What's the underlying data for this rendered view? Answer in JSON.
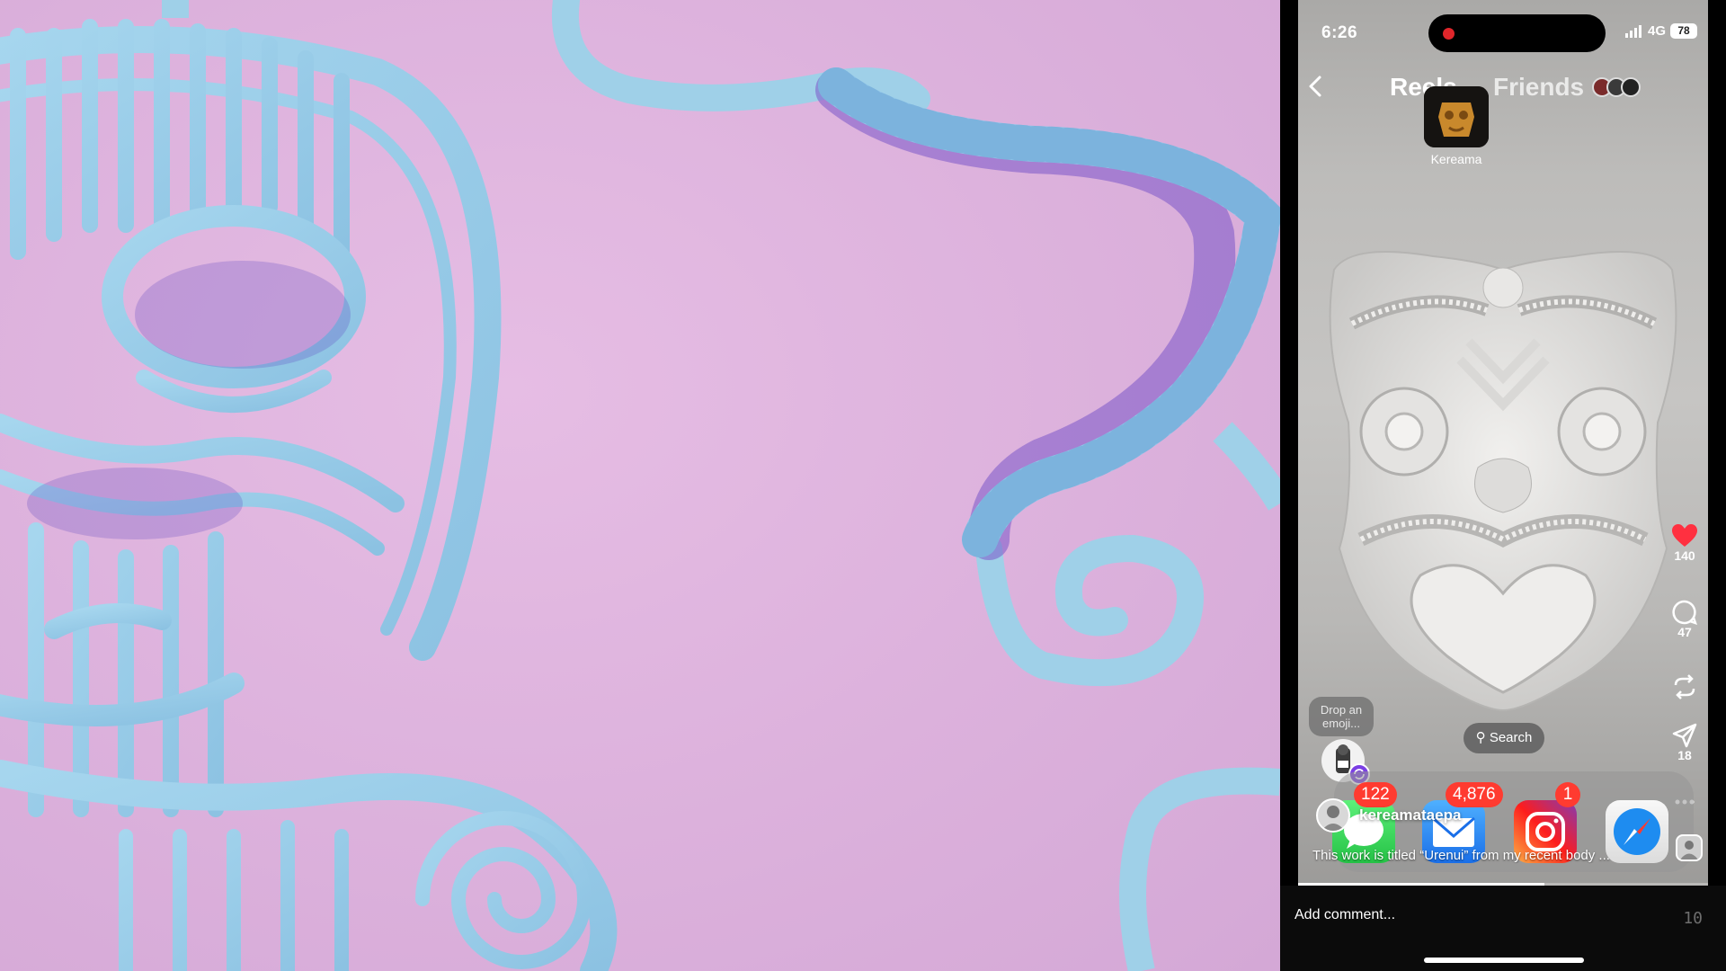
{
  "statusbar": {
    "time": "6:26",
    "network": "4G",
    "battery": "78"
  },
  "nav": {
    "back_icon": "chevron-left-icon",
    "tabs": [
      {
        "label": "Reels",
        "active": true
      },
      {
        "label": "Friends",
        "active": false
      }
    ]
  },
  "profile_highlight": {
    "name": "Kereama"
  },
  "rail": {
    "likes": "140",
    "comments": "47",
    "shares": "18",
    "like_color": "#ff3040"
  },
  "emoji_prompt": {
    "text_line1": "Drop an",
    "text_line2": "emoji..."
  },
  "search": {
    "label": "Search"
  },
  "dock": {
    "apps": [
      {
        "name": "Messages",
        "badge": "122"
      },
      {
        "name": "Mail",
        "badge": "4,876"
      },
      {
        "name": "Instagram",
        "badge": "1"
      },
      {
        "name": "Safari",
        "badge": ""
      }
    ]
  },
  "post": {
    "username": "kereamataepa",
    "caption": "This work is titled “Urenui” from my recent body ..."
  },
  "comment_bar": {
    "placeholder": "Add comment...",
    "count": "10"
  },
  "colors": {
    "art_bg": "#dcb1dc",
    "art_blue": "#96cbe6",
    "badge_red": "#ff3b30"
  }
}
